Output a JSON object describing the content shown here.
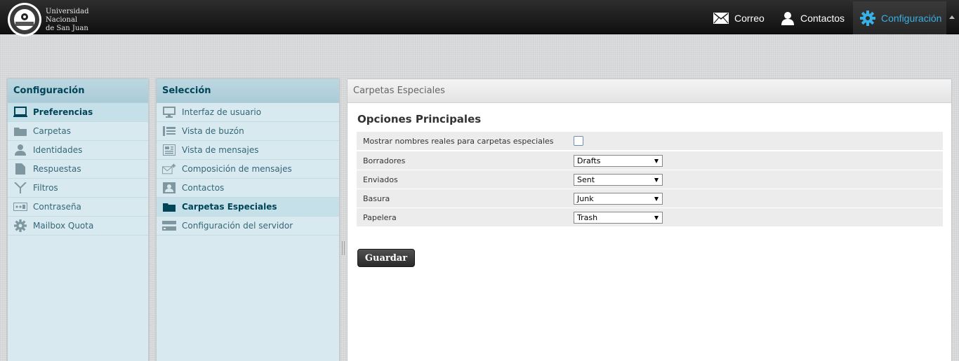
{
  "brand": {
    "line1": "Universidad",
    "line2": "Nacional",
    "line3": "de San Juan"
  },
  "topnav": {
    "correo": "Correo",
    "contactos": "Contactos",
    "configuracion": "Configuración",
    "active_color": "#38b0e6"
  },
  "sidebar": {
    "title": "Configuración",
    "items": [
      {
        "label": "Preferencias",
        "icon": "monitor-icon",
        "selected": true
      },
      {
        "label": "Carpetas",
        "icon": "folder-icon"
      },
      {
        "label": "Identidades",
        "icon": "user-icon"
      },
      {
        "label": "Respuestas",
        "icon": "document-icon"
      },
      {
        "label": "Filtros",
        "icon": "filter-icon"
      },
      {
        "label": "Contraseña",
        "icon": "password-icon"
      },
      {
        "label": "Mailbox Quota",
        "icon": "gear-icon"
      }
    ]
  },
  "selection": {
    "title": "Selección",
    "items": [
      {
        "label": "Interfaz de usuario",
        "icon": "monitor-icon"
      },
      {
        "label": "Vista de buzón",
        "icon": "list-icon"
      },
      {
        "label": "Vista de mensajes",
        "icon": "message-icon"
      },
      {
        "label": "Composición de mensajes",
        "icon": "compose-icon"
      },
      {
        "label": "Contactos",
        "icon": "contact-card-icon"
      },
      {
        "label": "Carpetas Especiales",
        "icon": "folder-icon",
        "selected": true
      },
      {
        "label": "Configuración del servidor",
        "icon": "server-icon"
      }
    ]
  },
  "content": {
    "header": "Carpetas Especiales",
    "section_title": "Opciones Principales",
    "show_real_names_label": "Mostrar nombres reales para carpetas especiales",
    "show_real_names_checked": false,
    "options": [
      {
        "label": "Borradores",
        "value": "Drafts"
      },
      {
        "label": "Enviados",
        "value": "Sent"
      },
      {
        "label": "Basura",
        "value": "Junk"
      },
      {
        "label": "Papelera",
        "value": "Trash"
      }
    ],
    "save_label": "Guardar"
  }
}
